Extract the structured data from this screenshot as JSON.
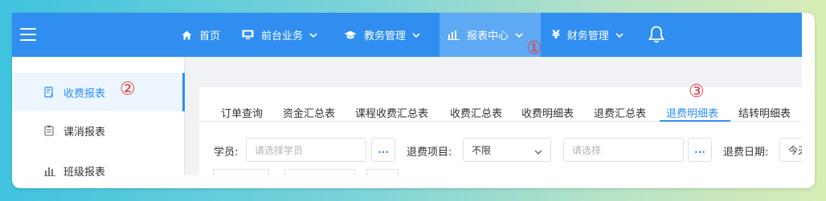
{
  "app": {
    "menu_icon": "hamburger-icon",
    "nav": [
      {
        "label": "首页",
        "icon": "home-icon"
      },
      {
        "label": "前台业务",
        "icon": "monitor-icon"
      },
      {
        "label": "教务管理",
        "icon": "graduation-cap-icon"
      },
      {
        "label": "报表中心",
        "icon": "bar-chart-icon"
      },
      {
        "label": "财务管理",
        "icon": "yen-icon"
      }
    ],
    "bell_icon": "bell-icon"
  },
  "sidebar": {
    "items": [
      {
        "label": "收费报表",
        "icon": "fee-report-icon"
      },
      {
        "label": "课消报表",
        "icon": "clipboard-icon"
      },
      {
        "label": "班级报表",
        "icon": "bar-chart-icon"
      }
    ]
  },
  "annotations": {
    "one": "①",
    "two": "②",
    "three": "③",
    "color": "#e23d3d"
  },
  "tabs": [
    "订单查询",
    "资金汇总表",
    "课程收费汇总表",
    "收费汇总表",
    "收费明细表",
    "退费汇总表",
    "退费明细表",
    "结转明细表"
  ],
  "active_tab": "退费明细表",
  "filters": {
    "student_label": "学员:",
    "student_placeholder": "请选择学员",
    "dots": "...",
    "refund_item_label": "退费项目:",
    "refund_item_value": "不限",
    "refund_item_detail_placeholder": "请选择",
    "refund_date_label": "退费日期:",
    "refund_date_value": "今天"
  },
  "colors": {
    "primary": "#2f8ef0",
    "nav_active": "#5ea9f4",
    "annotation": "#e23d3d"
  }
}
